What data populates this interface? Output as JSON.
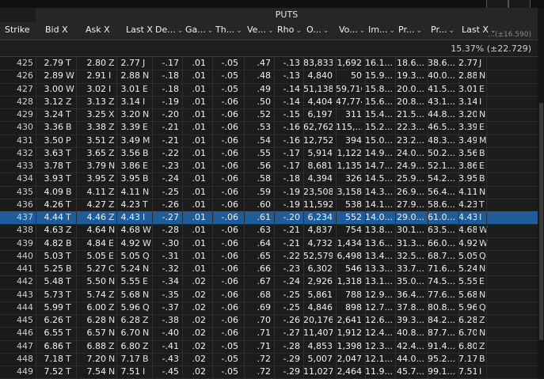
{
  "window": {
    "title": "PUTS"
  },
  "header": {
    "strike": "Strike",
    "columns": [
      {
        "label": "Bid X",
        "sort": ""
      },
      {
        "label": "Ask X",
        "sort": ""
      },
      {
        "label": "Last X",
        "sort": ""
      },
      {
        "label": "De...",
        "sort": "⌄"
      },
      {
        "label": "Ga...",
        "sort": "⌄"
      },
      {
        "label": "Th...",
        "sort": "⌄"
      },
      {
        "label": "Ve...",
        "sort": "⌄"
      },
      {
        "label": "Rho",
        "sort": "⌄"
      },
      {
        "label": "O...",
        "sort": "⌄"
      },
      {
        "label": "Vo...",
        "sort": "⌄"
      },
      {
        "label": "Im...",
        "sort": "⌄"
      },
      {
        "label": "Pr...",
        "sort": "⌄"
      },
      {
        "label": "Pr...",
        "sort": "⌄"
      },
      {
        "label": "Last X",
        "sort": "⌄"
      }
    ],
    "faint_value": "…(±16.590)"
  },
  "summary": {
    "implied_vol": "15.37% (±22.729)"
  },
  "selected_strike": "437",
  "rows": [
    {
      "strike": "425",
      "bid": "2.79",
      "bx": "T",
      "ask": "2.80",
      "ax": "Z",
      "last": "2.77",
      "lx": "J",
      "delta": "-.17",
      "gamma": ".01",
      "theta": "-.05",
      "vega": ".47",
      "rho": "-.13",
      "oi": "83,833",
      "vol": "1,692",
      "iv": "16.1...",
      "p1": "18.6...",
      "p2": "38.6...",
      "last2": "2.77",
      "lx2": "J"
    },
    {
      "strike": "426",
      "bid": "2.89",
      "bx": "W",
      "ask": "2.91",
      "ax": "I",
      "last": "2.88",
      "lx": "N",
      "delta": "-.18",
      "gamma": ".01",
      "theta": "-.05",
      "vega": ".48",
      "rho": "-.13",
      "oi": "4,840",
      "vol": "50",
      "iv": "15.9...",
      "p1": "19.3...",
      "p2": "40.0...",
      "last2": "2.88",
      "lx2": "N"
    },
    {
      "strike": "427",
      "bid": "3.00",
      "bx": "W",
      "ask": "3.02",
      "ax": "I",
      "last": "3.01",
      "lx": "E",
      "delta": "-.18",
      "gamma": ".01",
      "theta": "-.05",
      "vega": ".49",
      "rho": "-.14",
      "oi": "51,138",
      "vol": "59,716",
      "iv": "15.8...",
      "p1": "20.0...",
      "p2": "41.5...",
      "last2": "3.01",
      "lx2": "E"
    },
    {
      "strike": "428",
      "bid": "3.12",
      "bx": "Z",
      "ask": "3.13",
      "ax": "Z",
      "last": "3.14",
      "lx": "I",
      "delta": "-.19",
      "gamma": ".01",
      "theta": "-.06",
      "vega": ".50",
      "rho": "-.14",
      "oi": "4,404",
      "vol": "47,774",
      "iv": "15.6...",
      "p1": "20.8...",
      "p2": "43.1...",
      "last2": "3.14",
      "lx2": "I"
    },
    {
      "strike": "429",
      "bid": "3.24",
      "bx": "T",
      "ask": "3.25",
      "ax": "X",
      "last": "3.20",
      "lx": "N",
      "delta": "-.20",
      "gamma": ".01",
      "theta": "-.06",
      "vega": ".52",
      "rho": "-.15",
      "oi": "6,197",
      "vol": "311",
      "iv": "15.4...",
      "p1": "21.5...",
      "p2": "44.8...",
      "last2": "3.20",
      "lx2": "N"
    },
    {
      "strike": "430",
      "bid": "3.36",
      "bx": "B",
      "ask": "3.38",
      "ax": "Z",
      "last": "3.39",
      "lx": "E",
      "delta": "-.21",
      "gamma": ".01",
      "theta": "-.06",
      "vega": ".53",
      "rho": "-.16",
      "oi": "62,762",
      "vol": "115,...",
      "iv": "15.2...",
      "p1": "22.3...",
      "p2": "46.5...",
      "last2": "3.39",
      "lx2": "E"
    },
    {
      "strike": "431",
      "bid": "3.50",
      "bx": "P",
      "ask": "3.51",
      "ax": "Z",
      "last": "3.49",
      "lx": "M",
      "delta": "-.21",
      "gamma": ".01",
      "theta": "-.06",
      "vega": ".54",
      "rho": "-.16",
      "oi": "12,752",
      "vol": "394",
      "iv": "15.0...",
      "p1": "23.2...",
      "p2": "48.3...",
      "last2": "3.49",
      "lx2": "M"
    },
    {
      "strike": "432",
      "bid": "3.63",
      "bx": "T",
      "ask": "3.65",
      "ax": "Z",
      "last": "3.56",
      "lx": "B",
      "delta": "-.22",
      "gamma": ".01",
      "theta": "-.06",
      "vega": ".55",
      "rho": "-.17",
      "oi": "5,914",
      "vol": "1,122",
      "iv": "14.9...",
      "p1": "24.0...",
      "p2": "50.2...",
      "last2": "3.56",
      "lx2": "B"
    },
    {
      "strike": "433",
      "bid": "3.78",
      "bx": "T",
      "ask": "3.79",
      "ax": "N",
      "last": "3.86",
      "lx": "E",
      "delta": "-.23",
      "gamma": ".01",
      "theta": "-.06",
      "vega": ".56",
      "rho": "-.17",
      "oi": "8,681",
      "vol": "1,135",
      "iv": "14.7...",
      "p1": "24.9...",
      "p2": "52.1...",
      "last2": "3.86",
      "lx2": "E"
    },
    {
      "strike": "434",
      "bid": "3.93",
      "bx": "T",
      "ask": "3.95",
      "ax": "Z",
      "last": "3.95",
      "lx": "B",
      "delta": "-.24",
      "gamma": ".01",
      "theta": "-.06",
      "vega": ".58",
      "rho": "-.18",
      "oi": "4,394",
      "vol": "326",
      "iv": "14.5...",
      "p1": "25.9...",
      "p2": "54.2...",
      "last2": "3.95",
      "lx2": "B"
    },
    {
      "strike": "435",
      "bid": "4.09",
      "bx": "B",
      "ask": "4.11",
      "ax": "Z",
      "last": "4.11",
      "lx": "N",
      "delta": "-.25",
      "gamma": ".01",
      "theta": "-.06",
      "vega": ".59",
      "rho": "-.19",
      "oi": "23,508",
      "vol": "3,158",
      "iv": "14.3...",
      "p1": "26.9...",
      "p2": "56.4...",
      "last2": "4.11",
      "lx2": "N"
    },
    {
      "strike": "436",
      "bid": "4.26",
      "bx": "T",
      "ask": "4.27",
      "ax": "Z",
      "last": "4.23",
      "lx": "T",
      "delta": "-.26",
      "gamma": ".01",
      "theta": "-.06",
      "vega": ".60",
      "rho": "-.19",
      "oi": "11,592",
      "vol": "538",
      "iv": "14.1...",
      "p1": "27.9...",
      "p2": "58.6...",
      "last2": "4.23",
      "lx2": "T"
    },
    {
      "strike": "437",
      "bid": "4.44",
      "bx": "T",
      "ask": "4.46",
      "ax": "Z",
      "last": "4.43",
      "lx": "I",
      "delta": "-.27",
      "gamma": ".01",
      "theta": "-.06",
      "vega": ".61",
      "rho": "-.20",
      "oi": "6,234",
      "vol": "552",
      "iv": "14.0...",
      "p1": "29.0...",
      "p2": "61.0...",
      "last2": "4.43",
      "lx2": "I"
    },
    {
      "strike": "438",
      "bid": "4.63",
      "bx": "Z",
      "ask": "4.64",
      "ax": "N",
      "last": "4.68",
      "lx": "W",
      "delta": "-.28",
      "gamma": ".01",
      "theta": "-.06",
      "vega": ".63",
      "rho": "-.21",
      "oi": "4,837",
      "vol": "754",
      "iv": "13.8...",
      "p1": "30.1...",
      "p2": "63.5...",
      "last2": "4.68",
      "lx2": "W"
    },
    {
      "strike": "439",
      "bid": "4.82",
      "bx": "B",
      "ask": "4.84",
      "ax": "E",
      "last": "4.92",
      "lx": "W",
      "delta": "-.30",
      "gamma": ".01",
      "theta": "-.06",
      "vega": ".64",
      "rho": "-.21",
      "oi": "4,732",
      "vol": "1,434",
      "iv": "13.6...",
      "p1": "31.3...",
      "p2": "66.0...",
      "last2": "4.92",
      "lx2": "W"
    },
    {
      "strike": "440",
      "bid": "5.03",
      "bx": "T",
      "ask": "5.05",
      "ax": "E",
      "last": "5.05",
      "lx": "Q",
      "delta": "-.31",
      "gamma": ".01",
      "theta": "-.06",
      "vega": ".65",
      "rho": "-.22",
      "oi": "52,579",
      "vol": "6,498",
      "iv": "13.4...",
      "p1": "32.5...",
      "p2": "68.7...",
      "last2": "5.05",
      "lx2": "Q"
    },
    {
      "strike": "441",
      "bid": "5.25",
      "bx": "B",
      "ask": "5.27",
      "ax": "C",
      "last": "5.24",
      "lx": "N",
      "delta": "-.32",
      "gamma": ".01",
      "theta": "-.06",
      "vega": ".66",
      "rho": "-.23",
      "oi": "6,302",
      "vol": "546",
      "iv": "13.3...",
      "p1": "33.7...",
      "p2": "71.6...",
      "last2": "5.24",
      "lx2": "N"
    },
    {
      "strike": "442",
      "bid": "5.48",
      "bx": "T",
      "ask": "5.50",
      "ax": "N",
      "last": "5.55",
      "lx": "E",
      "delta": "-.34",
      "gamma": ".02",
      "theta": "-.06",
      "vega": ".67",
      "rho": "-.24",
      "oi": "2,926",
      "vol": "1,318",
      "iv": "13.1...",
      "p1": "35.0...",
      "p2": "74.5...",
      "last2": "5.55",
      "lx2": "E"
    },
    {
      "strike": "443",
      "bid": "5.73",
      "bx": "T",
      "ask": "5.74",
      "ax": "Z",
      "last": "5.68",
      "lx": "N",
      "delta": "-.35",
      "gamma": ".02",
      "theta": "-.06",
      "vega": ".68",
      "rho": "-.25",
      "oi": "5,861",
      "vol": "788",
      "iv": "12.9...",
      "p1": "36.4...",
      "p2": "77.6...",
      "last2": "5.68",
      "lx2": "N"
    },
    {
      "strike": "444",
      "bid": "5.99",
      "bx": "T",
      "ask": "6.00",
      "ax": "Z",
      "last": "5.96",
      "lx": "Q",
      "delta": "-.37",
      "gamma": ".02",
      "theta": "-.06",
      "vega": ".69",
      "rho": "-.25",
      "oi": "4,846",
      "vol": "898",
      "iv": "12.7...",
      "p1": "37.8...",
      "p2": "80.8...",
      "last2": "5.96",
      "lx2": "Q"
    },
    {
      "strike": "445",
      "bid": "6.26",
      "bx": "T",
      "ask": "6.28",
      "ax": "N",
      "last": "6.28",
      "lx": "Z",
      "delta": "-.38",
      "gamma": ".02",
      "theta": "-.06",
      "vega": ".70",
      "rho": "-.26",
      "oi": "20,176",
      "vol": "2,641",
      "iv": "12.6...",
      "p1": "39.3...",
      "p2": "84.2...",
      "last2": "6.28",
      "lx2": "Z"
    },
    {
      "strike": "446",
      "bid": "6.55",
      "bx": "T",
      "ask": "6.57",
      "ax": "N",
      "last": "6.70",
      "lx": "N",
      "delta": "-.40",
      "gamma": ".02",
      "theta": "-.06",
      "vega": ".71",
      "rho": "-.27",
      "oi": "11,407",
      "vol": "1,912",
      "iv": "12.4...",
      "p1": "40.8...",
      "p2": "87.7...",
      "last2": "6.70",
      "lx2": "N"
    },
    {
      "strike": "447",
      "bid": "6.86",
      "bx": "T",
      "ask": "6.88",
      "ax": "Z",
      "last": "6.80",
      "lx": "Z",
      "delta": "-.41",
      "gamma": ".02",
      "theta": "-.05",
      "vega": ".71",
      "rho": "-.28",
      "oi": "4,853",
      "vol": "1,398",
      "iv": "12.3...",
      "p1": "42.4...",
      "p2": "91.4...",
      "last2": "6.80",
      "lx2": "Z"
    },
    {
      "strike": "448",
      "bid": "7.18",
      "bx": "T",
      "ask": "7.20",
      "ax": "N",
      "last": "7.17",
      "lx": "B",
      "delta": "-.43",
      "gamma": ".02",
      "theta": "-.05",
      "vega": ".72",
      "rho": "-.29",
      "oi": "5,007",
      "vol": "2,047",
      "iv": "12.1...",
      "p1": "44.0...",
      "p2": "95.2...",
      "last2": "7.17",
      "lx2": "B"
    },
    {
      "strike": "449",
      "bid": "7.52",
      "bx": "T",
      "ask": "7.54",
      "ax": "N",
      "last": "7.51",
      "lx": "I",
      "delta": "-.45",
      "gamma": ".02",
      "theta": "-.05",
      "vega": ".72",
      "rho": "-.29",
      "oi": "11,027",
      "vol": "2,464",
      "iv": "11.9...",
      "p1": "45.7...",
      "p2": "99.1...",
      "last2": "7.51",
      "lx2": "I"
    }
  ]
}
